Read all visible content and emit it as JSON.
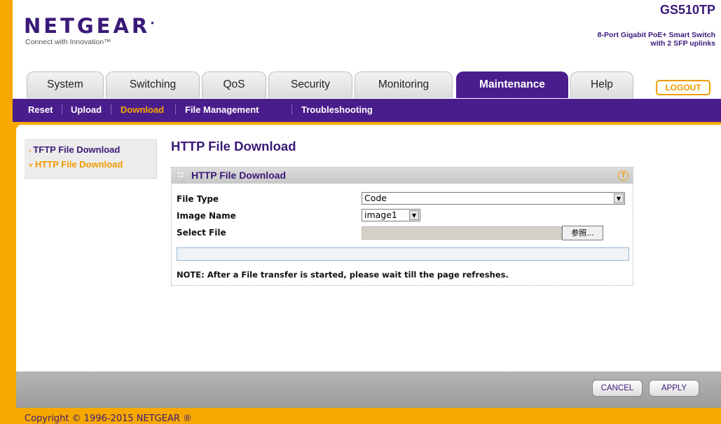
{
  "header": {
    "logo": "NETGEAR",
    "tagline": "Connect with Innovation™",
    "model": "GS510TP",
    "model_desc_line1": "8-Port Gigabit PoE+ Smart Switch",
    "model_desc_line2": "with 2 SFP uplinks"
  },
  "tabs": {
    "system": "System",
    "switching": "Switching",
    "qos": "QoS",
    "security": "Security",
    "monitoring": "Monitoring",
    "maintenance": "Maintenance",
    "help": "Help",
    "logout": "LOGOUT"
  },
  "subnav": {
    "reset": "Reset",
    "upload": "Upload",
    "download": "Download",
    "file_management": "File Management",
    "troubleshooting": "Troubleshooting"
  },
  "leftnav": {
    "tftp": "TFTP File Download",
    "http": "HTTP File Download"
  },
  "main": {
    "page_title": "HTTP File Download",
    "panel_title": "HTTP File Download",
    "file_type_label": "File Type",
    "file_type_value": "Code",
    "image_name_label": "Image Name",
    "image_name_value": "image1",
    "select_file_label": "Select File",
    "browse_label": "参照...",
    "note": "NOTE: After a File transfer is started, please wait till the page refreshes."
  },
  "footer": {
    "cancel": "CANCEL",
    "apply": "APPLY",
    "copyright": "Copyright © 1996-2015 NETGEAR ®"
  },
  "colors": {
    "brand_purple": "#4a1d8c",
    "accent_orange": "#f7a800"
  }
}
